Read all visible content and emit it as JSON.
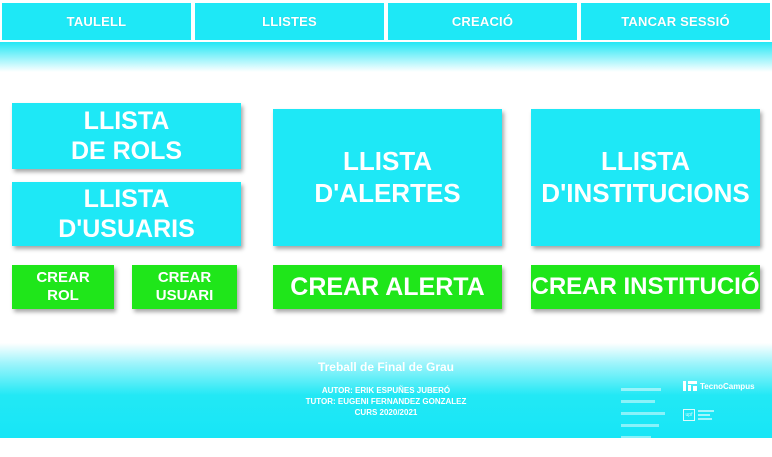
{
  "nav": {
    "items": [
      "TAULELL",
      "LLISTES",
      "CREACIÓ",
      "TANCAR SESSIÓ"
    ]
  },
  "tiles": {
    "llista_rols": "LLISTA\nDE ROLS",
    "llista_usuaris": "LLISTA\nD'USUARIS",
    "llista_alertes": "LLISTA\nD'ALERTES",
    "llista_institucions": "LLISTA\nD'INSTITUCIONS",
    "crear_rol": "CREAR\nROL",
    "crear_usuari": "CREAR\nUSUARI",
    "crear_alerta": "CREAR ALERTA",
    "crear_institucio": "CREAR INSTITUCIÓ"
  },
  "footer": {
    "title": "Treball de Final de Grau",
    "author": "AUTOR: ERIK ESPUÑES JUBERÓ",
    "tutor": "TUTOR: EUGENI FERNANDEZ GONZALEZ",
    "course": "CURS 2020/2021",
    "logo_text": "TecnoCampus"
  },
  "colors": {
    "accent": "#1ee8f6",
    "action": "#1fe61a",
    "text": "#ffffff"
  }
}
